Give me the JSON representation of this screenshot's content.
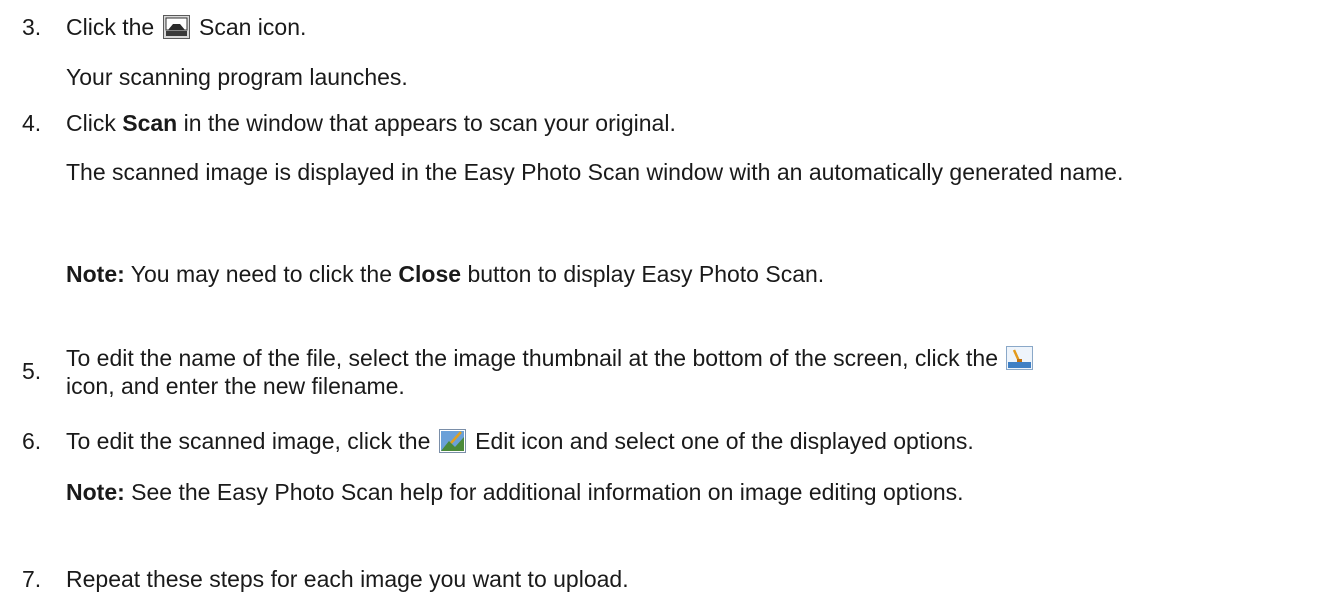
{
  "steps": [
    {
      "number": "3.",
      "pre": "Click the",
      "icon": "scan-icon",
      "post": "Scan icon.",
      "result": "Your scanning program launches."
    },
    {
      "number": "4.",
      "pre": "Click",
      "bold": "Scan",
      "post": "in the window that appears to scan your original.",
      "result": "The scanned image is displayed in the Easy Photo Scan window with an automatically generated name.",
      "note": {
        "label": "Note:",
        "pre": "You may need to click the",
        "bold": "Close",
        "post": "button to display Easy Photo Scan."
      }
    },
    {
      "number": "5.",
      "pre": "To edit the name of the file, select the image thumbnail at the bottom of the screen, click the",
      "icon": "rename-icon",
      "post": "icon, and enter the new filename."
    },
    {
      "number": "6.",
      "pre": "To edit the scanned image, click the",
      "icon": "edit-icon",
      "post": "Edit icon and select one of the displayed options.",
      "note": {
        "label": "Note:",
        "text": "See the Easy Photo Scan help for additional information on image editing options."
      }
    },
    {
      "number": "7.",
      "text": "Repeat these steps for each image you want to upload."
    }
  ]
}
